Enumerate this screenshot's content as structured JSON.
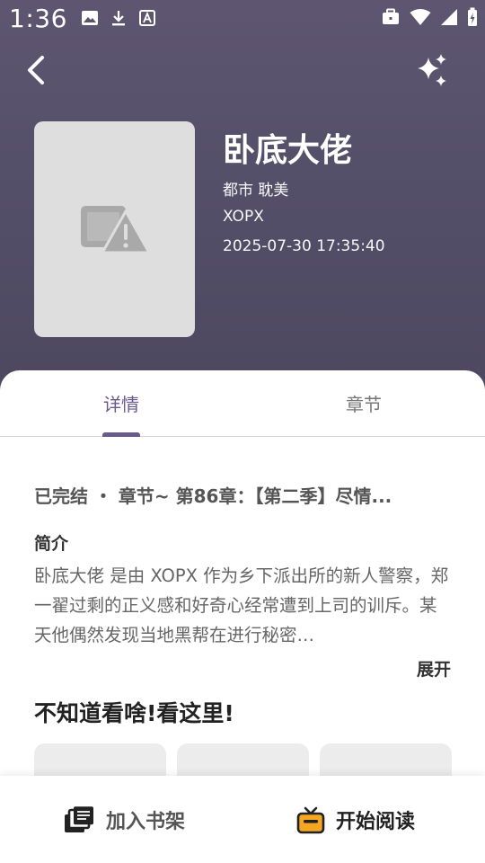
{
  "status_bar": {
    "time": "1:36",
    "left_icons": [
      "image-icon",
      "download-icon",
      "text-box-icon"
    ],
    "right_icons": [
      "briefcase-icon",
      "wifi-icon",
      "signal-icon",
      "battery-charging-icon"
    ]
  },
  "nav": {
    "back_icon": "chevron-left-icon",
    "action_icon": "sparkle-icon"
  },
  "book": {
    "title": "卧底大佬",
    "tags": "都市 耽美",
    "author": "XOPX",
    "updated": "2025-07-30 17:35:40",
    "cover_icon": "image-error-icon"
  },
  "tabs": [
    {
      "label": "详情",
      "active": true
    },
    {
      "label": "章节",
      "active": false
    }
  ],
  "details": {
    "status_line": "已完结 ・ 章节~ 第86章：【第二季】尽情...",
    "intro_label": "简介",
    "intro_text": "卧底大佬 是由 XOPX 作为乡下派出所的新人警察，郑一翟过剩的正义感和好奇心经常遭到上司的训斥。某天他偶然发现当地黑帮在进行秘密…",
    "expand_label": "展开",
    "recommend_title": "不知道看啥!看这里!"
  },
  "bottom_bar": {
    "add_shelf_label": "加入书架",
    "add_shelf_icon": "bookshelf-icon",
    "start_read_label": "开始阅读",
    "start_read_icon": "tv-icon"
  },
  "colors": {
    "header_bg": "#55506a",
    "accent": "#6a5a8c",
    "read_icon_accent": "#f5a623"
  }
}
